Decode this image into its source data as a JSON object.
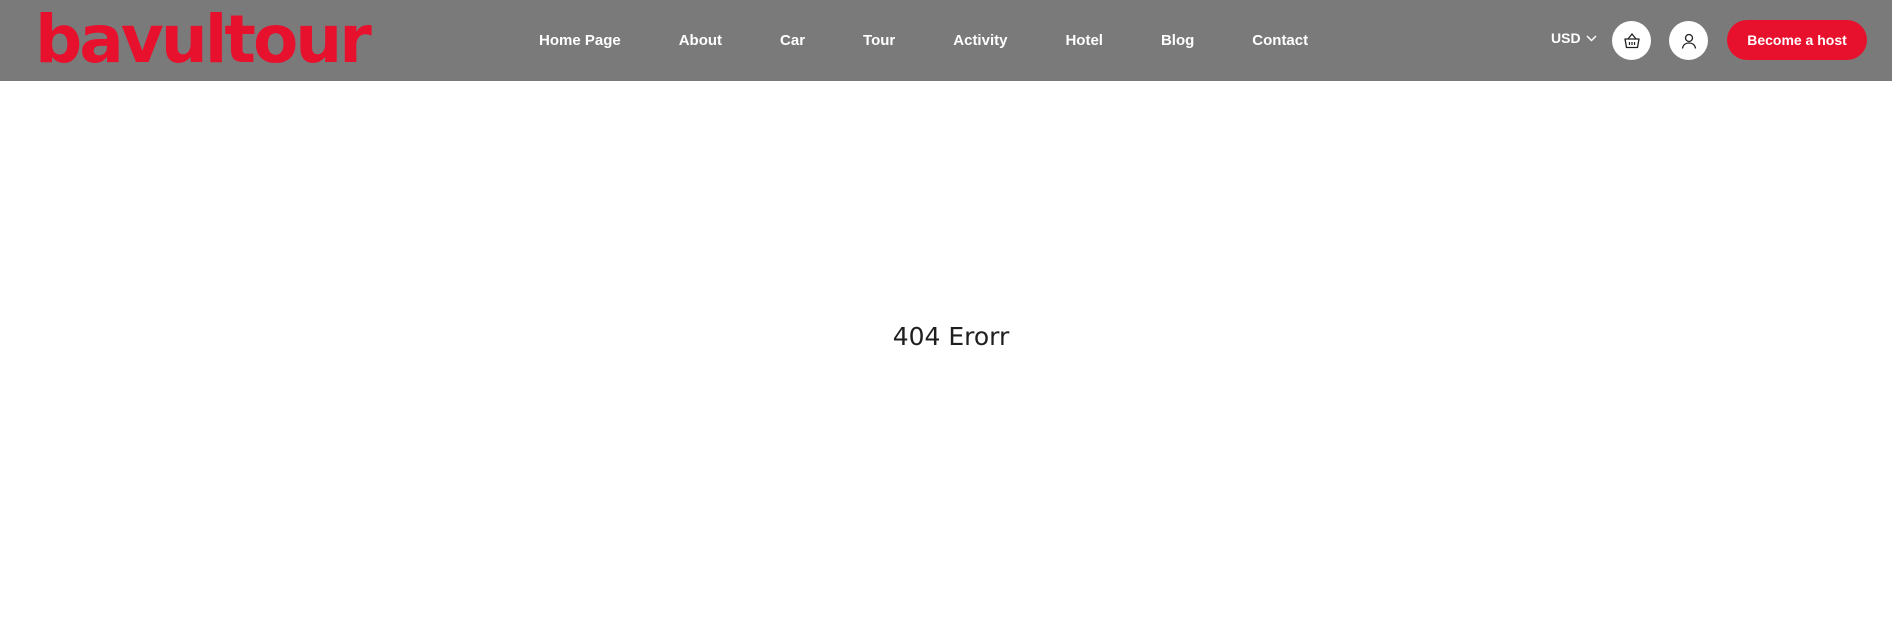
{
  "header": {
    "logo_text": "bavultour",
    "nav": [
      {
        "label": "Home Page"
      },
      {
        "label": "About"
      },
      {
        "label": "Car"
      },
      {
        "label": "Tour"
      },
      {
        "label": "Activity"
      },
      {
        "label": "Hotel"
      },
      {
        "label": "Blog"
      },
      {
        "label": "Contact"
      }
    ],
    "currency": "USD",
    "cart_icon": "basket-icon",
    "user_icon": "user-icon",
    "host_button_label": "Become a host"
  },
  "main": {
    "error_message": "404 Erorr"
  },
  "colors": {
    "header_bg": "#7a7a7a",
    "brand_red": "#e8112d",
    "page_bg": "#ffffff"
  }
}
